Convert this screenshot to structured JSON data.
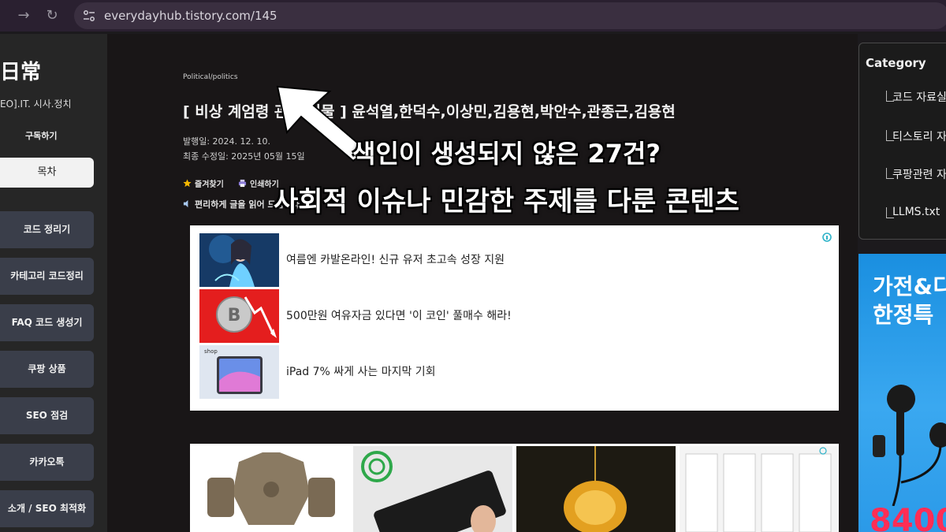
{
  "browser": {
    "url": "everydayhub.tistory.com/145",
    "forward_icon": "arrow-right-icon",
    "reload_icon": "reload-icon",
    "site_info_icon": "tune-icon"
  },
  "sidebar": {
    "blog_title": "日常",
    "blog_desc": "EO].IT. 시사.정치",
    "subscribe_label": "구독하기",
    "toc_label": "목차",
    "menu": [
      "코드 정리기",
      "카테고리 코드정리",
      "FAQ 코드 생성기",
      "쿠팡 상품",
      "SEO 점검",
      "카카오톡",
      "소개 / SEO 최적화"
    ]
  },
  "article": {
    "category": "Political/politics",
    "title": "[ 비상 계엄령 관련 인물 ] 윤석열,한덕수,이상민,김용현,박안수,관종근,김용현",
    "published": "발행일: 2024. 12. 10.",
    "updated": "최종 수정일: 2025년 05월 15일",
    "bookmark_label": "즐겨찾기",
    "print_label": "인쇄하기",
    "tts_label": "편리하게 글을 읽어 드립니다."
  },
  "ads": {
    "items": [
      "여름엔 카발온라인! 신규 유저 초고속 성장 지원",
      "500만원 여유자금 있다면 '이 코인' 풀매수 해라!",
      "iPad 7% 싸게 사는 마지막 기회"
    ],
    "shop_label": "shop"
  },
  "right_sidebar": {
    "category_title": "Category",
    "categories": [
      "코드 자료실",
      "티스토리 자료",
      "쿠팡관련 자료",
      "LLMS.txt"
    ],
    "banner_line1": "가전&디",
    "banner_line2": "한정특",
    "banner_price": "8400"
  },
  "overlay": {
    "line1": "색인이 생성되지 않은 27건?",
    "line2": "사회적 이슈나 민감한 주제를 다룬 콘텐츠"
  },
  "colors": {
    "accent_button": "#3a3e4a",
    "banner_blue": "#1a8fe0",
    "price_red": "#ff2d55"
  }
}
